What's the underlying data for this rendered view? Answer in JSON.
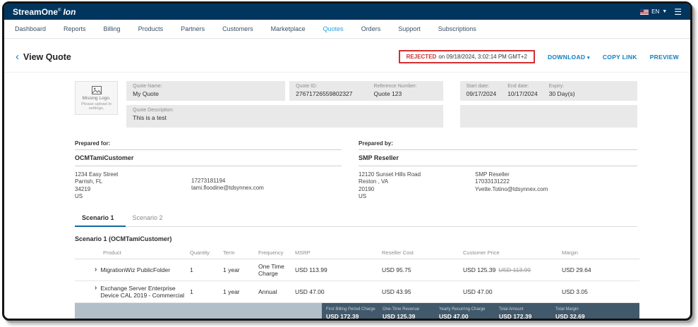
{
  "topbar": {
    "brand": "StreamOne",
    "reg": "®",
    "product": "Ion",
    "language": "EN"
  },
  "nav": {
    "items": [
      {
        "label": "Dashboard"
      },
      {
        "label": "Reports"
      },
      {
        "label": "Billing"
      },
      {
        "label": "Products"
      },
      {
        "label": "Partners"
      },
      {
        "label": "Customers"
      },
      {
        "label": "Marketplace"
      },
      {
        "label": "Quotes"
      },
      {
        "label": "Orders"
      },
      {
        "label": "Support"
      },
      {
        "label": "Subscriptions"
      }
    ]
  },
  "header": {
    "back": "‹",
    "title": "View Quote",
    "status": {
      "label": "REJECTED",
      "detail": "on 09/18/2024, 3:02:14 PM GMT+2"
    },
    "actions": {
      "download": "DOWNLOAD",
      "download_caret": "▾",
      "copy_link": "COPY LINK",
      "preview": "PREVIEW"
    }
  },
  "quote": {
    "missing_logo_title": "Missing Logo.",
    "missing_logo_subtitle": "Please upload in settings.",
    "name_label": "Quote Name:",
    "name": "My Quote",
    "id_label": "Quote ID:",
    "id": "27671726559802327",
    "reference_label": "Reference Number:",
    "reference": "Quote 123",
    "start_label": "Start date:",
    "start": "09/17/2024",
    "end_label": "End date:",
    "end": "10/17/2024",
    "expiry_label": "Expiry:",
    "expiry": "30 Day(s)",
    "description_label": "Quote Description:",
    "description": "This is a test"
  },
  "prepared_for": {
    "heading": "Prepared for:",
    "name": "OCMTamiCustomer",
    "address": [
      "1234 Easy Street",
      "Parrish, FL",
      "34219",
      "US"
    ],
    "contact": [
      "17273181194",
      "tami.floodine@tdsynnex.com"
    ]
  },
  "prepared_by": {
    "heading": "Prepared by:",
    "name": "SMP Reseller",
    "address": [
      "12120 Sunset Hills Road",
      "Reston , VA",
      "20190",
      "US"
    ],
    "contact": [
      "SMP Reseller",
      "17033131222",
      "Yvette.Totino@tdsynnex.com"
    ]
  },
  "tabs": [
    {
      "label": "Scenario 1"
    },
    {
      "label": "Scenario 2"
    }
  ],
  "scenario": {
    "title": "Scenario 1 (OCMTamiCustomer)",
    "table": {
      "headers": [
        "Product",
        "Quantity",
        "Term",
        "Frequency",
        "MSRP",
        "Reseller Cost",
        "Customer Price",
        "Margin"
      ],
      "rows": [
        {
          "expand": "›",
          "product": "MigrationWiz PublicFolder",
          "quantity": "1",
          "term": "1 year",
          "frequency": "One Time Charge",
          "msrp": "USD 113.99",
          "reseller_cost": "USD 95.75",
          "customer_price": "USD 125.39",
          "customer_price_old": "USD 113.99",
          "margin": "USD 29.64"
        },
        {
          "expand": "›",
          "product": "Exchange Server Enterprise Device CAL 2019 - Commercial",
          "quantity": "1",
          "term": "1 year",
          "frequency": "Annual",
          "msrp": "USD 47.00",
          "reseller_cost": "USD 43.95",
          "customer_price": "USD 47.00",
          "customer_price_old": "",
          "margin": "USD 3.05"
        }
      ],
      "totals": [
        {
          "label": "First Billing Period Charge",
          "value": "USD 172.39"
        },
        {
          "label": "One-Time Revenue",
          "value": "USD 125.39"
        },
        {
          "label": "Yearly Recurring Charge",
          "value": "USD 47.00"
        },
        {
          "label": "Total Amount",
          "value": "USD 172.39"
        },
        {
          "label": "Total Margin",
          "value": "USD 32.69"
        }
      ]
    }
  }
}
